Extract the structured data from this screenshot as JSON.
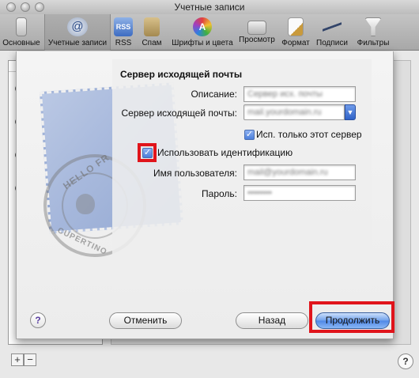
{
  "window": {
    "title": "Учетные записи"
  },
  "toolbar": {
    "items": [
      {
        "label": "Основные",
        "icon": "switch-icon"
      },
      {
        "label": "Учетные записи",
        "icon": "at-sign-icon"
      },
      {
        "label": "RSS",
        "icon": "rss-icon"
      },
      {
        "label": "Спам",
        "icon": "trash-icon"
      },
      {
        "label": "Шрифты и цвета",
        "icon": "font-icon"
      },
      {
        "label": "Просмотр",
        "icon": "view-icon"
      },
      {
        "label": "Формат",
        "icon": "pen-icon"
      },
      {
        "label": "Подписи",
        "icon": "signature-icon"
      },
      {
        "label": "Фильтры",
        "icon": "filter-icon"
      }
    ]
  },
  "sheet": {
    "heading": "Сервер исходящей почты",
    "description": {
      "label": "Описание:",
      "value": "Сервер исх. почты"
    },
    "server": {
      "label": "Сервер исходящей почты:",
      "value": "mail.yourdomain.ru"
    },
    "only_this_server": {
      "label": "Исп. только этот сервер",
      "checked": true
    },
    "use_auth": {
      "label": "Использовать идентификацию",
      "checked": true
    },
    "username": {
      "label": "Имя пользователя:",
      "value": "mail@yourdomain.ru"
    },
    "password": {
      "label": "Пароль:",
      "value": "••••••••"
    },
    "buttons": {
      "cancel": "Отменить",
      "back": "Назад",
      "continue": "Продолжить"
    },
    "help": "?"
  },
  "bottom": {
    "add": "+",
    "remove": "−",
    "help": "?"
  },
  "colors": {
    "highlight": "#e0141b",
    "default_button": "#4f88e6"
  }
}
